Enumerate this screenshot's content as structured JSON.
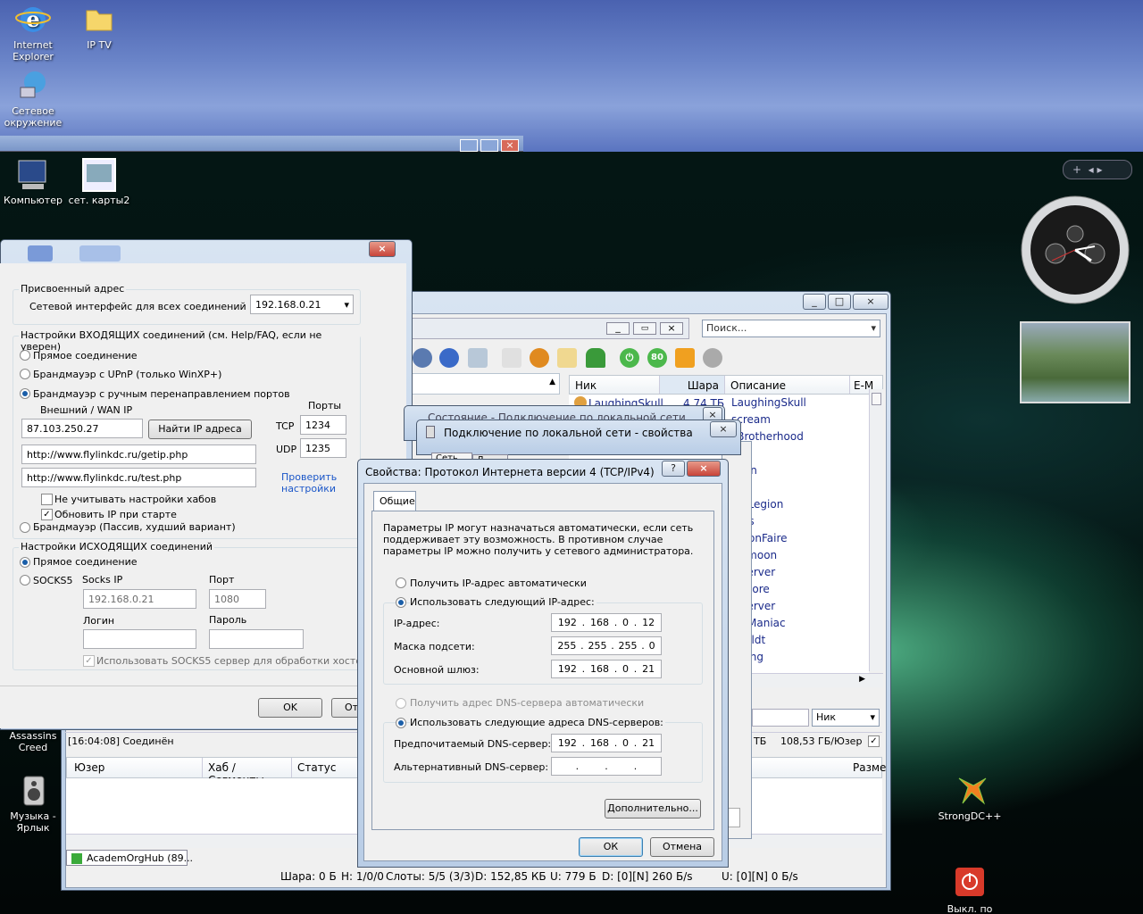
{
  "desktop": {
    "icons": [
      {
        "label": "Internet Explorer",
        "icon": "ie-icon"
      },
      {
        "label": "IP TV",
        "icon": "folder-icon"
      },
      {
        "label": "Сетевое окружение",
        "icon": "network-icon"
      },
      {
        "label": "Компьютер",
        "icon": "computer-icon"
      },
      {
        "label": "сет. карты2",
        "icon": "image-icon"
      },
      {
        "label": "Assassins Creed",
        "icon": "game-icon"
      },
      {
        "label": "Музыка - Ярлык",
        "icon": "speaker-icon"
      },
      {
        "label": "StrongDC++",
        "icon": "strongdc-icon"
      },
      {
        "label": "Выкл. по",
        "icon": "power-icon"
      }
    ]
  },
  "settings_dialog": {
    "assigned_group": "Присвоенный адрес",
    "net_iface_label": "Сетевой интерфейс для всех соединений",
    "net_iface_value": "192.168.0.21",
    "incoming_group": "Настройки ВХОДЯЩИХ соединений (см. Help/FAQ, если не уверен)",
    "opt_direct": "Прямое соединение",
    "opt_upnp": "Брандмауэр с UPnP (только WinXP+)",
    "opt_manual": "Брандмауэр с ручным перенаправлением портов",
    "ports_label": "Порты",
    "wan_label": "Внешний / WAN IP",
    "wan_value": "87.103.250.27",
    "find_ip_button": "Найти IP адреса",
    "tcp_label": "TCP",
    "tcp_value": "1234",
    "udp_label": "UDP",
    "udp_value": "1235",
    "getip_url": "http://www.flylinkdc.ru/getip.php",
    "test_url": "http://www.flylinkdc.ru/test.php",
    "check_link": "Проверить настройки",
    "ignore_hubs": "Не учитывать настройки хабов",
    "update_ip": "Обновить IP при старте",
    "opt_passive": "Брандмауэр (Пассив, худший вариант)",
    "outgoing_group": "Настройки ИСХОДЯЩИХ соединений",
    "out_direct": "Прямое соединение",
    "out_socks": "SOCKS5",
    "socks_ip_label": "Socks IP",
    "socks_ip_value": "192.168.0.21",
    "port_label": "Порт",
    "port_value": "1080",
    "login_label": "Логин",
    "password_label": "Пароль",
    "use_socks_hosts": "Использовать SOCKS5 сервер для обработки хостов",
    "ok_button": "OK",
    "cancel_partial": "От"
  },
  "dc_client": {
    "search_placeholder": "Поиск...",
    "columns": [
      "Ник",
      "Шара",
      "Описание",
      "E-M"
    ],
    "first_row_nick": "LaughingSkull",
    "first_row_share": "4,74 ТБ",
    "descriptions": [
      "LaughingSkull",
      "scream",
      "sBrotherhood",
      "nas",
      "zhan",
      "ong",
      "ingLegion",
      "aros",
      "moonFaire",
      "owmoon",
      "e server",
      "enCore",
      "e server",
      "aloManiac",
      "nholdt",
      "hwing"
    ],
    "nick_select": "Ник",
    "log_line": "[16:04:08] Соединён",
    "share_per_user": "108,53 ГБ/Юзер",
    "tb_partial": "ТБ",
    "transfer_columns": [
      "Юзер",
      "Хаб / Сегменты",
      "Статус",
      "Разме"
    ],
    "hub_tab": "AcademOrgHub (89...",
    "status": {
      "share": "Шара: 0 Б",
      "hubs": "H: 1/0/0",
      "slots": "Слоты: 5/5 (3/3)",
      "download": "D: 152,85 КБ",
      "upload": "U: 779 Б",
      "dl_rate": "D: [0][N] 260 Б/s",
      "ul_rate": "U: [0][N] 0 Б/s"
    }
  },
  "status_window_title": "Состояние - Подключение по локальной сети",
  "lan_props": {
    "title": "Подключение по локальной сети - свойства",
    "tab1": "Сеть",
    "tab2": "Д..."
  },
  "ipv4": {
    "title": "Свойства: Протокол Интернета версии 4 (TCP/IPv4)",
    "help_button": "?",
    "tab_general": "Общие",
    "description": "Параметры IP могут назначаться автоматически, если сеть поддерживает эту возможность. В противном случае параметры IP можно получить у сетевого администратора.",
    "auto_ip": "Получить IP-адрес автоматически",
    "manual_ip": "Использовать следующий IP-адрес:",
    "ip_label": "IP-адрес:",
    "ip": [
      "192",
      "168",
      "0",
      "12"
    ],
    "mask_label": "Маска подсети:",
    "mask": [
      "255",
      "255",
      "255",
      "0"
    ],
    "gw_label": "Основной шлюз:",
    "gw": [
      "192",
      "168",
      "0",
      "21"
    ],
    "auto_dns": "Получить адрес DNS-сервера автоматически",
    "manual_dns": "Использовать следующие адреса DNS-серверов:",
    "pref_dns_label": "Предпочитаемый DNS-сервер:",
    "pref_dns": [
      "192",
      "168",
      "0",
      "21"
    ],
    "alt_dns_label": "Альтернативный DNS-сервер:",
    "advanced_button": "Дополнительно...",
    "ok_button": "ОК",
    "cancel_button": "Отмена"
  }
}
